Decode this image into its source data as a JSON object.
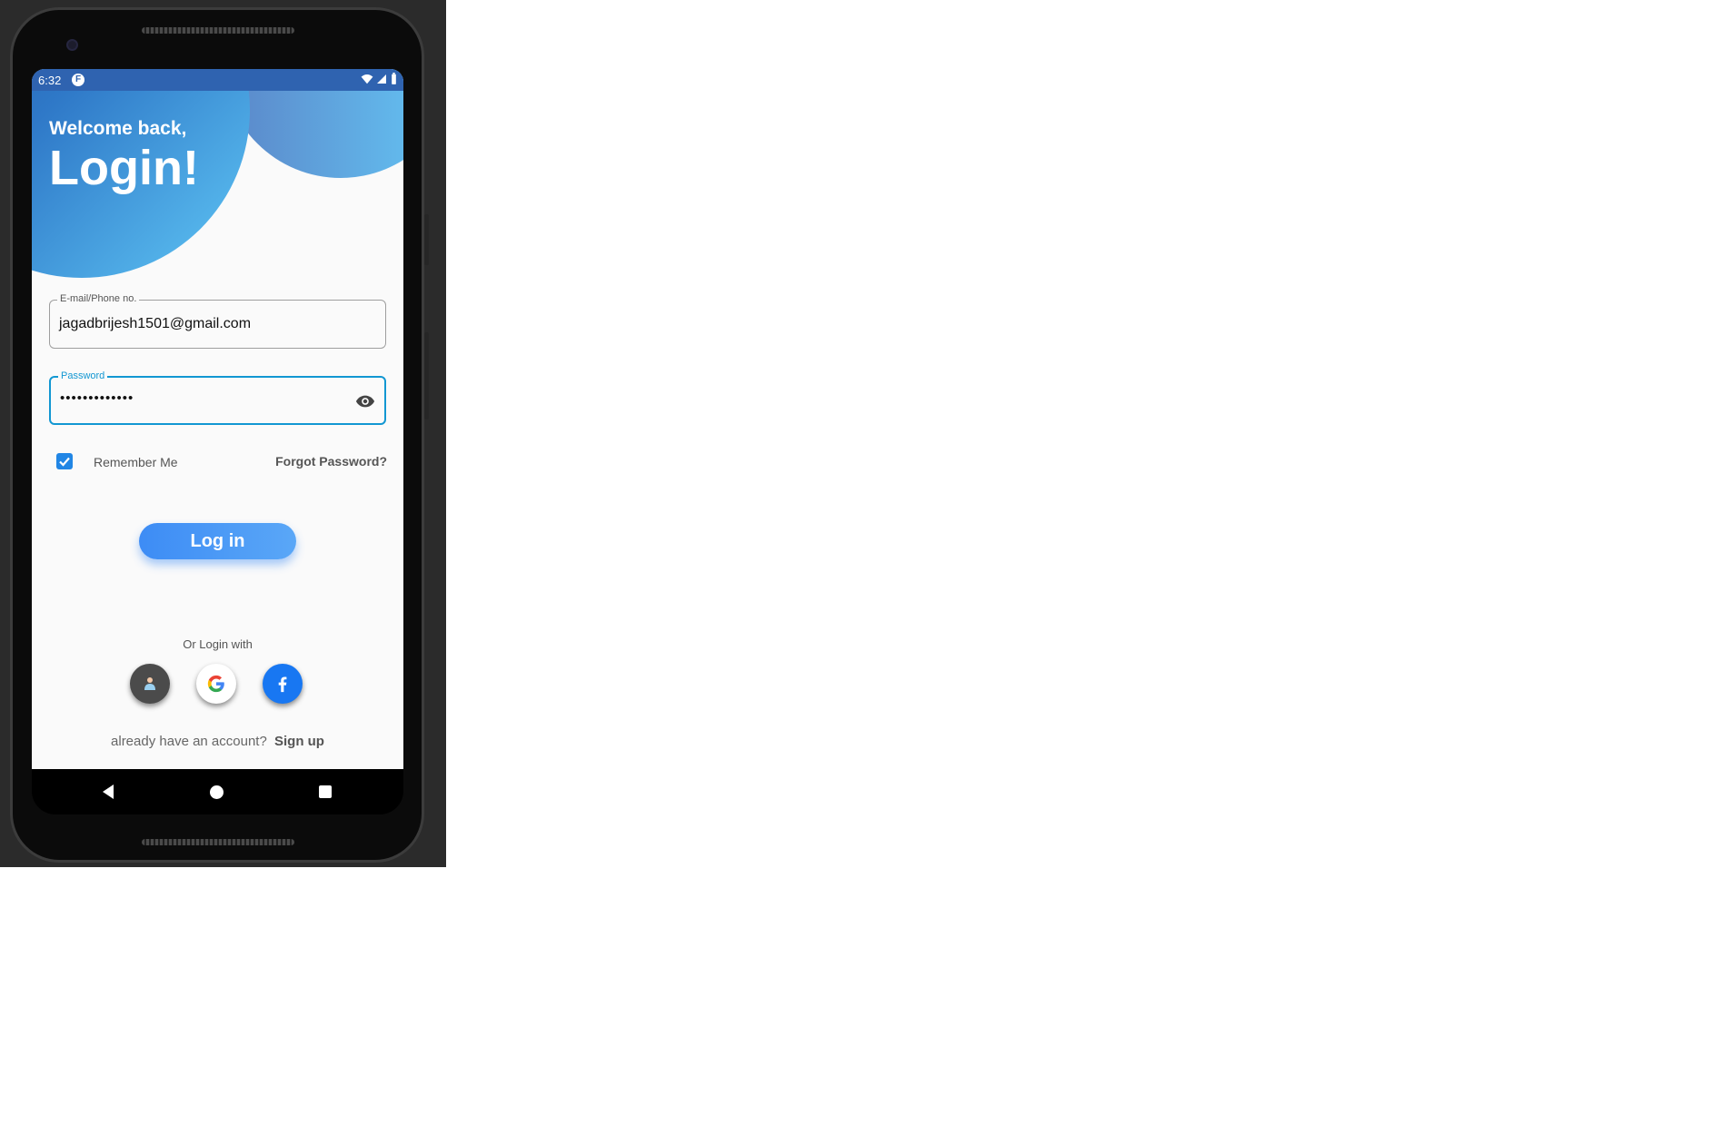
{
  "statusbar": {
    "time": "6:32",
    "app_icon_letter": "F"
  },
  "header": {
    "welcome": "Welcome back,",
    "title": "Login!"
  },
  "form": {
    "email_label": "E-mail/Phone no.",
    "email_value": "jagadbrijesh1501@gmail.com",
    "password_label": "Password",
    "password_value": "•••••••••••••",
    "remember_label": "Remember Me",
    "remember_checked": true,
    "forgot_label": "Forgot Password?",
    "login_button": "Log in"
  },
  "social": {
    "caption": "Or Login with",
    "providers": [
      "anonymous",
      "google",
      "facebook"
    ]
  },
  "footer": {
    "prompt": "already have an account?",
    "signup_link": "Sign up"
  },
  "colors": {
    "accent": "#1297d2",
    "button": "#3d8cf5",
    "statusbar": "#2f63b0"
  }
}
